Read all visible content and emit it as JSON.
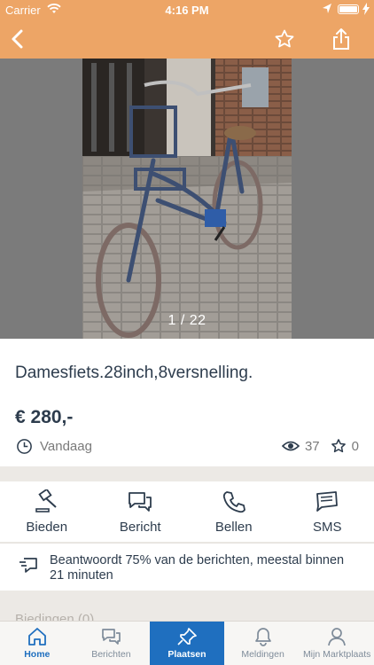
{
  "status": {
    "carrier": "Carrier",
    "time": "4:16 PM"
  },
  "nav": {
    "back_icon": "chevron-left-icon",
    "favorite_icon": "star-icon",
    "share_icon": "share-icon"
  },
  "gallery": {
    "counter": "1 / 22"
  },
  "listing": {
    "title": "Damesfiets.28inch,8versnelling.",
    "price": "€ 280,-",
    "date": "Vandaag",
    "views": "37",
    "favorites": "0"
  },
  "actions": [
    {
      "label": "Bieden",
      "icon": "gavel-icon"
    },
    {
      "label": "Bericht",
      "icon": "chat-icon"
    },
    {
      "label": "Bellen",
      "icon": "phone-icon"
    },
    {
      "label": "SMS",
      "icon": "sms-icon"
    }
  ],
  "response_info": "Beantwoordt 75% van de berichten, meestal binnen 21 minuten",
  "bids_peek": "Biedingen (0)",
  "tabs": [
    {
      "label": "Home",
      "icon": "home-icon"
    },
    {
      "label": "Berichten",
      "icon": "messages-icon"
    },
    {
      "label": "Plaatsen",
      "icon": "place-ad-icon"
    },
    {
      "label": "Meldingen",
      "icon": "bell-icon"
    },
    {
      "label": "Mijn Marktplaats",
      "icon": "user-icon"
    }
  ],
  "colors": {
    "accent": "#eda566",
    "brand_blue": "#1f6fbf",
    "text": "#2d3c4d"
  }
}
